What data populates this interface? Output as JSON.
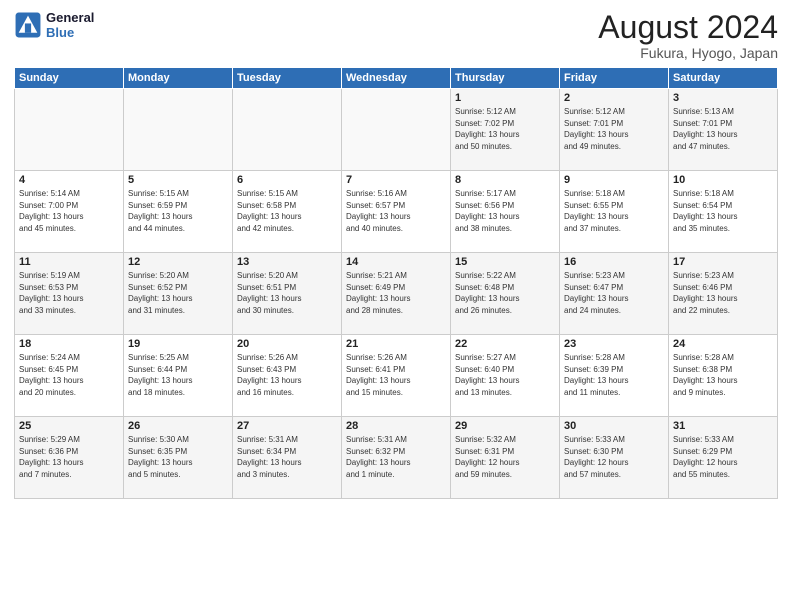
{
  "header": {
    "logo_line1": "General",
    "logo_line2": "Blue",
    "title": "August 2024",
    "subtitle": "Fukura, Hyogo, Japan"
  },
  "days_of_week": [
    "Sunday",
    "Monday",
    "Tuesday",
    "Wednesday",
    "Thursday",
    "Friday",
    "Saturday"
  ],
  "weeks": [
    [
      {
        "day": "",
        "info": ""
      },
      {
        "day": "",
        "info": ""
      },
      {
        "day": "",
        "info": ""
      },
      {
        "day": "",
        "info": ""
      },
      {
        "day": "1",
        "info": "Sunrise: 5:12 AM\nSunset: 7:02 PM\nDaylight: 13 hours\nand 50 minutes."
      },
      {
        "day": "2",
        "info": "Sunrise: 5:12 AM\nSunset: 7:01 PM\nDaylight: 13 hours\nand 49 minutes."
      },
      {
        "day": "3",
        "info": "Sunrise: 5:13 AM\nSunset: 7:01 PM\nDaylight: 13 hours\nand 47 minutes."
      }
    ],
    [
      {
        "day": "4",
        "info": "Sunrise: 5:14 AM\nSunset: 7:00 PM\nDaylight: 13 hours\nand 45 minutes."
      },
      {
        "day": "5",
        "info": "Sunrise: 5:15 AM\nSunset: 6:59 PM\nDaylight: 13 hours\nand 44 minutes."
      },
      {
        "day": "6",
        "info": "Sunrise: 5:15 AM\nSunset: 6:58 PM\nDaylight: 13 hours\nand 42 minutes."
      },
      {
        "day": "7",
        "info": "Sunrise: 5:16 AM\nSunset: 6:57 PM\nDaylight: 13 hours\nand 40 minutes."
      },
      {
        "day": "8",
        "info": "Sunrise: 5:17 AM\nSunset: 6:56 PM\nDaylight: 13 hours\nand 38 minutes."
      },
      {
        "day": "9",
        "info": "Sunrise: 5:18 AM\nSunset: 6:55 PM\nDaylight: 13 hours\nand 37 minutes."
      },
      {
        "day": "10",
        "info": "Sunrise: 5:18 AM\nSunset: 6:54 PM\nDaylight: 13 hours\nand 35 minutes."
      }
    ],
    [
      {
        "day": "11",
        "info": "Sunrise: 5:19 AM\nSunset: 6:53 PM\nDaylight: 13 hours\nand 33 minutes."
      },
      {
        "day": "12",
        "info": "Sunrise: 5:20 AM\nSunset: 6:52 PM\nDaylight: 13 hours\nand 31 minutes."
      },
      {
        "day": "13",
        "info": "Sunrise: 5:20 AM\nSunset: 6:51 PM\nDaylight: 13 hours\nand 30 minutes."
      },
      {
        "day": "14",
        "info": "Sunrise: 5:21 AM\nSunset: 6:49 PM\nDaylight: 13 hours\nand 28 minutes."
      },
      {
        "day": "15",
        "info": "Sunrise: 5:22 AM\nSunset: 6:48 PM\nDaylight: 13 hours\nand 26 minutes."
      },
      {
        "day": "16",
        "info": "Sunrise: 5:23 AM\nSunset: 6:47 PM\nDaylight: 13 hours\nand 24 minutes."
      },
      {
        "day": "17",
        "info": "Sunrise: 5:23 AM\nSunset: 6:46 PM\nDaylight: 13 hours\nand 22 minutes."
      }
    ],
    [
      {
        "day": "18",
        "info": "Sunrise: 5:24 AM\nSunset: 6:45 PM\nDaylight: 13 hours\nand 20 minutes."
      },
      {
        "day": "19",
        "info": "Sunrise: 5:25 AM\nSunset: 6:44 PM\nDaylight: 13 hours\nand 18 minutes."
      },
      {
        "day": "20",
        "info": "Sunrise: 5:26 AM\nSunset: 6:43 PM\nDaylight: 13 hours\nand 16 minutes."
      },
      {
        "day": "21",
        "info": "Sunrise: 5:26 AM\nSunset: 6:41 PM\nDaylight: 13 hours\nand 15 minutes."
      },
      {
        "day": "22",
        "info": "Sunrise: 5:27 AM\nSunset: 6:40 PM\nDaylight: 13 hours\nand 13 minutes."
      },
      {
        "day": "23",
        "info": "Sunrise: 5:28 AM\nSunset: 6:39 PM\nDaylight: 13 hours\nand 11 minutes."
      },
      {
        "day": "24",
        "info": "Sunrise: 5:28 AM\nSunset: 6:38 PM\nDaylight: 13 hours\nand 9 minutes."
      }
    ],
    [
      {
        "day": "25",
        "info": "Sunrise: 5:29 AM\nSunset: 6:36 PM\nDaylight: 13 hours\nand 7 minutes."
      },
      {
        "day": "26",
        "info": "Sunrise: 5:30 AM\nSunset: 6:35 PM\nDaylight: 13 hours\nand 5 minutes."
      },
      {
        "day": "27",
        "info": "Sunrise: 5:31 AM\nSunset: 6:34 PM\nDaylight: 13 hours\nand 3 minutes."
      },
      {
        "day": "28",
        "info": "Sunrise: 5:31 AM\nSunset: 6:32 PM\nDaylight: 13 hours\nand 1 minute."
      },
      {
        "day": "29",
        "info": "Sunrise: 5:32 AM\nSunset: 6:31 PM\nDaylight: 12 hours\nand 59 minutes."
      },
      {
        "day": "30",
        "info": "Sunrise: 5:33 AM\nSunset: 6:30 PM\nDaylight: 12 hours\nand 57 minutes."
      },
      {
        "day": "31",
        "info": "Sunrise: 5:33 AM\nSunset: 6:29 PM\nDaylight: 12 hours\nand 55 minutes."
      }
    ]
  ]
}
